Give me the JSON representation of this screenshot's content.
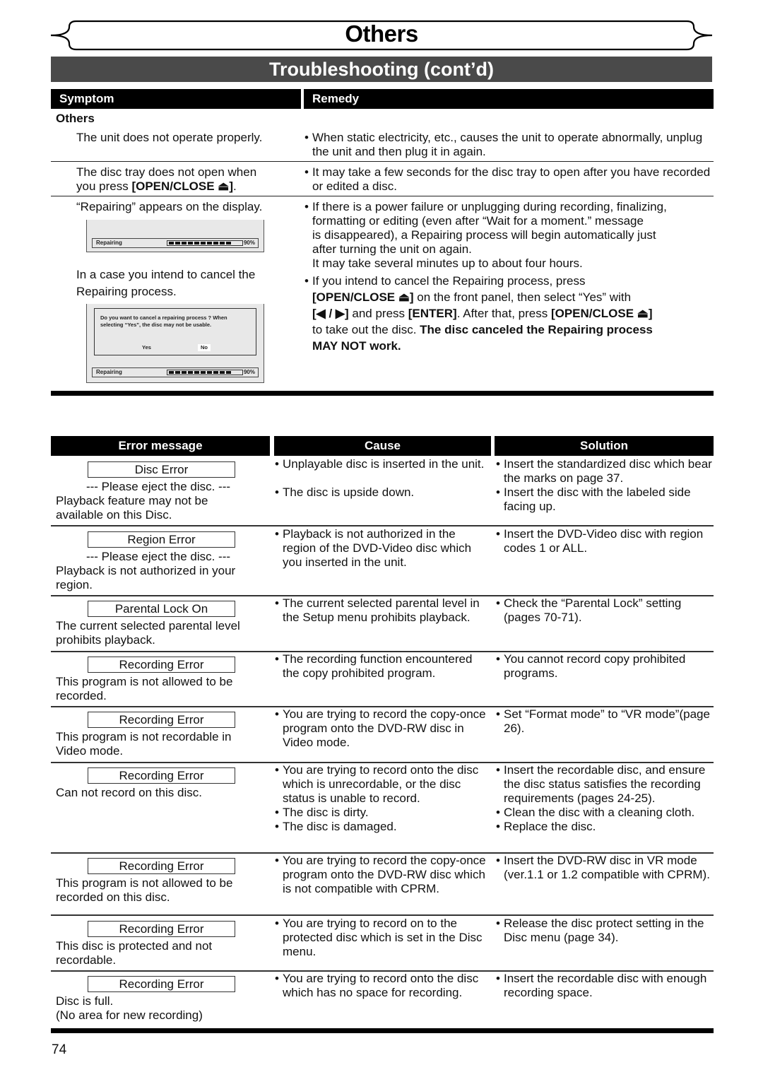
{
  "header": {
    "banner_title": "Others",
    "subtitle": "Troubleshooting (cont’d)"
  },
  "symptom_table": {
    "columns": [
      "Symptom",
      "Remedy"
    ],
    "category": "Others",
    "rows": [
      {
        "symptom": "The unit does not operate properly.",
        "remedy": [
          "When static electricity, etc., causes the unit to operate abnormally, unplug the unit and then plug it in again."
        ]
      },
      {
        "symptom_line1": "The disc tray does not open when",
        "symptom_line2_prefix": "you press ",
        "symptom_line2_bold": "[OPEN/CLOSE ⏏]",
        "symptom_line2_suffix": ".",
        "remedy": [
          "It may take a few seconds for the disc tray to open after you have recorded or edited a disc."
        ]
      },
      {
        "symptom": "“Repairing” appears on the display.",
        "symptom2": "In a case you intend to cancel the Repairing process.",
        "remedy1_lines": [
          "If there is a power failure or unplugging during recording, finalizing,",
          "formatting or editing (even after “Wait for a moment.” message",
          "is disappeared), a Repairing process will begin automatically just",
          "after turning the unit on again.",
          "It may take several minutes up to about four hours."
        ],
        "remedy2": {
          "l1": "If you intend to cancel the Repairing process, press",
          "l2_bold": "[OPEN/CLOSE ⏏]",
          "l2_rest": " on the front panel, then select “Yes” with",
          "l3_bold1": "[◀ / ▶]",
          "l3_mid": " and press ",
          "l3_bold2": "[ENTER]",
          "l3_mid2": ". After that, press ",
          "l3_bold3": "[OPEN/CLOSE ⏏]",
          "l4_plain": "to take out the disc. ",
          "l4_bold": "The disc canceled the Repairing process",
          "l5_bold": "MAY NOT work."
        }
      }
    ],
    "osd": {
      "bar_label": "Repairing",
      "progress_percent_label": "90%",
      "progress_fraction": 0.9,
      "dialog_message": "Do you want to cancel a repairing process ? When selecting “Yes”, the disc may not be usable.",
      "yes_label": "Yes",
      "no_label": "No"
    }
  },
  "error_table": {
    "columns": [
      "Error message",
      "Cause",
      "Solution"
    ],
    "rows": [
      {
        "message": "Disc Error",
        "detail_lines": [
          "--- Please eject the disc. ---",
          "Playback feature may not be",
          "available on this Disc."
        ],
        "causes": [
          "Unplayable disc is inserted in the unit.",
          "The disc is upside down."
        ],
        "solutions": [
          "Insert the standardized disc which bear the marks on page 37.",
          "Insert the disc with the labeled side facing up."
        ]
      },
      {
        "message": "Region Error",
        "detail_lines": [
          "--- Please eject the disc. ---",
          "Playback is not authorized in your",
          "region."
        ],
        "causes": [
          "Playback is not authorized in the region of the DVD-Video disc which you inserted in the unit."
        ],
        "solutions": [
          "Insert the DVD-Video disc with region codes 1 or ALL."
        ]
      },
      {
        "message": "Parental Lock On",
        "detail_lines": [
          "The current selected parental level",
          "prohibits playback."
        ],
        "causes": [
          "The current selected parental level in the Setup menu prohibits playback."
        ],
        "solutions": [
          "Check the “Parental Lock” setting (pages 70-71)."
        ]
      },
      {
        "message": "Recording Error",
        "detail_lines": [
          "This program is not allowed to be",
          "recorded."
        ],
        "causes": [
          "The recording function encountered the copy prohibited program."
        ],
        "solutions": [
          "You cannot record copy prohibited programs."
        ]
      },
      {
        "message": "Recording Error",
        "detail_lines": [
          "This program is not recordable in",
          "Video mode."
        ],
        "causes": [
          "You are trying to record the copy-once program onto the DVD-RW disc in Video mode."
        ],
        "solutions": [
          "Set “Format mode” to “VR mode”(page 26)."
        ]
      },
      {
        "message": "Recording Error",
        "detail_lines": [
          "Can not record on this disc."
        ],
        "causes": [
          "You are trying to record onto the disc which is unrecordable, or the disc status is unable to record.",
          "The disc is dirty.",
          "The disc is damaged."
        ],
        "solutions": [
          "Insert the recordable disc, and ensure the disc status satisfies the recording requirements (pages 24-25).",
          "Clean the disc with a cleaning cloth.",
          "Replace the disc."
        ]
      },
      {
        "message": "Recording Error",
        "detail_lines": [
          "This program is not allowed to be",
          "recorded on this disc."
        ],
        "causes": [
          "You are trying to record the copy-once program onto the DVD-RW disc which is not compatible with CPRM."
        ],
        "solutions": [
          "Insert the DVD-RW disc in VR mode (ver.1.1 or 1.2 compatible with CPRM)."
        ]
      },
      {
        "message": "Recording Error",
        "detail_lines": [
          "This disc is protected and not",
          "recordable."
        ],
        "causes": [
          "You are trying to record on to the protected disc which is set in the Disc menu."
        ],
        "solutions": [
          "Release the disc protect setting in the Disc menu (page 34)."
        ]
      },
      {
        "message": "Recording Error",
        "detail_lines": [
          "Disc is full.",
          "(No area for new recording)"
        ],
        "causes": [
          "You are trying to record onto the disc which has no space for recording."
        ],
        "solutions": [
          "Insert the recordable disc with enough recording space."
        ]
      }
    ]
  },
  "footer": {
    "page_number": "74"
  }
}
